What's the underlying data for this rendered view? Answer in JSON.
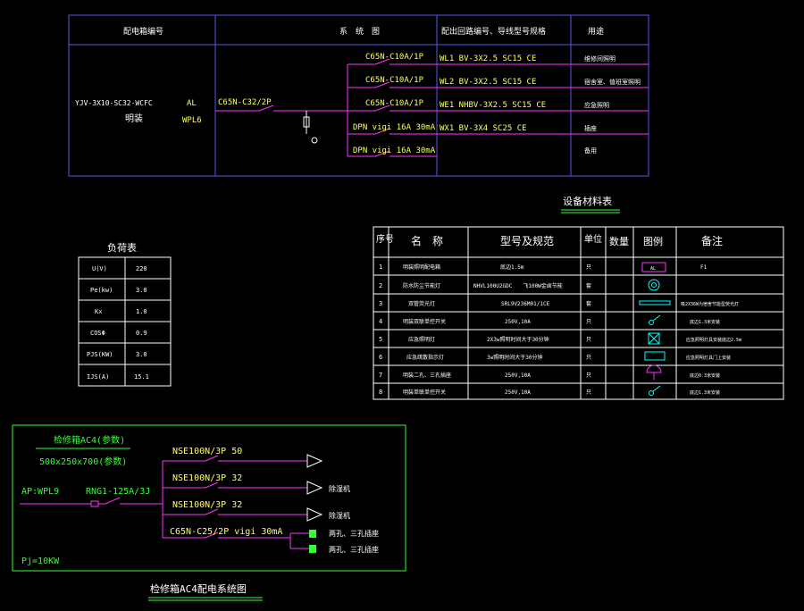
{
  "top_panel": {
    "headers": {
      "panel_no": "配电箱编号",
      "system": "系　统　图",
      "circuit": "配出回路编号、导线型号规格",
      "usage": "用途"
    },
    "incoming_cable": "YJV-3X10-SC32-WCFC",
    "box_id": "AL",
    "mount": "明装",
    "feeder_id": "WPL6",
    "main_breaker": "C65N-C32/2P",
    "branches": [
      {
        "breaker": "C65N-C10A/1P",
        "circuit": "WL1  BV-3X2.5 SC15 CE",
        "usage": "维修间照明"
      },
      {
        "breaker": "C65N-C10A/1P",
        "circuit": "WL2  BV-3X2.5 SC15 CE",
        "usage": "宿舍室、值班室照明"
      },
      {
        "breaker": "C65N-C10A/1P",
        "circuit": "WE1  NHBV-3X2.5 SC15 CE",
        "usage": "应急照明"
      },
      {
        "breaker": "DPN vigi 16A  30mA",
        "circuit": "WX1  BV-3X4  SC25  CE",
        "usage": "插座"
      },
      {
        "breaker": "DPN vigi 16A  30mA",
        "circuit": "",
        "usage": "备用"
      }
    ]
  },
  "load_table": {
    "title": "负荷表",
    "rows": [
      {
        "k": "U(V)",
        "v": "220"
      },
      {
        "k": "Pe(kw)",
        "v": "3.0"
      },
      {
        "k": "Kx",
        "v": "1.0"
      },
      {
        "k": "COSΦ",
        "v": "0.9"
      },
      {
        "k": "PJS(KW)",
        "v": "3.0"
      },
      {
        "k": "IJS(A)",
        "v": "15.1"
      }
    ]
  },
  "equip_table": {
    "title": "设备材料表",
    "headers": {
      "no": "序号",
      "name": "名　称",
      "model": "型号及规范",
      "unit": "单位",
      "qty": "数量",
      "legend": "图例",
      "note": "备注"
    },
    "rows": [
      {
        "no": "1",
        "name": "明装照明配电箱",
        "model": "底边1.5m",
        "unit": "只",
        "legend_text": "AL",
        "note": "F1"
      },
      {
        "no": "2",
        "name": "防水防尘节能灯",
        "model": "NHVL100U2GDC　　飞100W金卤节能",
        "unit": "套",
        "note": ""
      },
      {
        "no": "3",
        "name": "双管荧光灯",
        "model": "SRL9V236M01/1CE",
        "unit": "套",
        "note": "吸2X36W为宿舍节能型荧光灯"
      },
      {
        "no": "4",
        "name": "明装双联单控开关",
        "model": "250V,10A",
        "unit": "只",
        "note": "底边1.3米安装"
      },
      {
        "no": "5",
        "name": "应急照明灯",
        "model": "2X3w照明时间大于30分钟",
        "unit": "只",
        "note": "应急照明灯具安装底边2.5m"
      },
      {
        "no": "6",
        "name": "应急疏散指示灯",
        "model": "3w照明时间大于30分钟",
        "unit": "只",
        "note": "应急照明灯具门上安装"
      },
      {
        "no": "7",
        "name": "明装二孔、三孔插座",
        "model": "250V,10A",
        "unit": "只",
        "note": "底边0.3米安装"
      },
      {
        "no": "8",
        "name": "明装单联单控开关",
        "model": "250V,10A",
        "unit": "只",
        "note": "底边1.3米安装"
      }
    ]
  },
  "bottom_panel": {
    "box_title": "检修箱AC4(参数)",
    "box_size": "500x250x700(参数)",
    "feed": "AP:WPL9",
    "main_switch": "RNG1-125A/3J",
    "power": "Pj=10KW",
    "branches": [
      {
        "breaker": "NSE100N/3P 50",
        "load": ""
      },
      {
        "breaker": "NSE100N/3P 32",
        "load": "除湿机"
      },
      {
        "breaker": "NSE100N/3P 32",
        "load": "除湿机"
      },
      {
        "breaker": "C65N-C25/2P vigi 30mA",
        "load": ""
      }
    ],
    "sockets": [
      "两孔、三孔插座",
      "两孔、三孔插座"
    ],
    "caption": "检修箱AC4配电系统图"
  },
  "colors": {
    "frame": "#6a6aff",
    "green": "#33ff33",
    "magenta": "#ff33ff",
    "yellow": "#ffff66",
    "white": "#ffffff",
    "cyan": "#00ffff",
    "bg": "#000000"
  }
}
